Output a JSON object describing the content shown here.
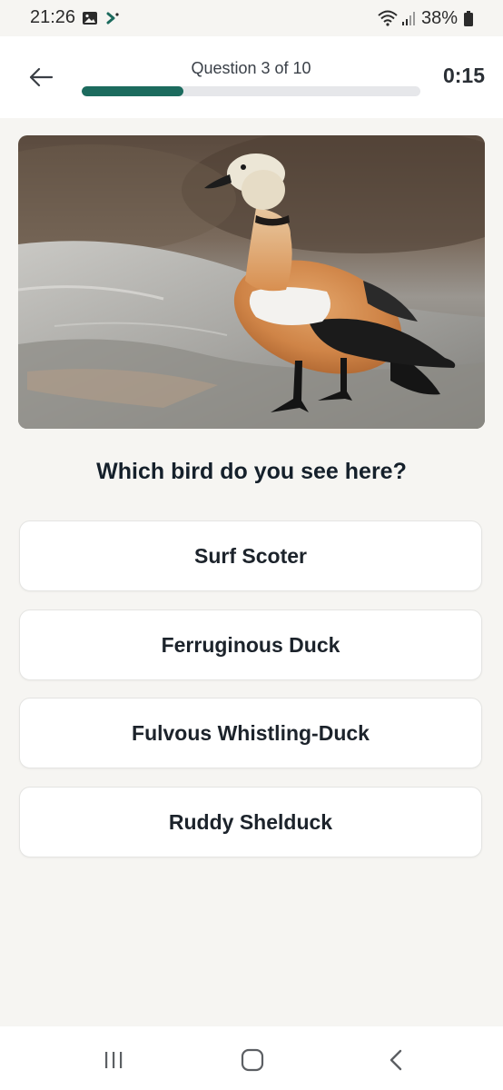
{
  "status_bar": {
    "time": "21:26",
    "battery": "38%",
    "icons": [
      "gallery-icon",
      "app-notification-icon",
      "wifi-icon",
      "signal-icon",
      "battery-icon"
    ]
  },
  "header": {
    "back_icon": "arrow-left-icon",
    "question_label": "Question 3 of 10",
    "progress": 0.3,
    "timer": "0:15",
    "accent_color": "#1c6b5e"
  },
  "quiz": {
    "question": "Which bird do you see here?",
    "options": [
      {
        "label": "Surf Scoter"
      },
      {
        "label": "Ferruginous Duck"
      },
      {
        "label": "Fulvous Whistling-Duck"
      },
      {
        "label": "Ruddy Shelduck"
      }
    ]
  },
  "nav_bar": {
    "icons": [
      "recent-apps-icon",
      "home-icon",
      "back-icon"
    ]
  }
}
